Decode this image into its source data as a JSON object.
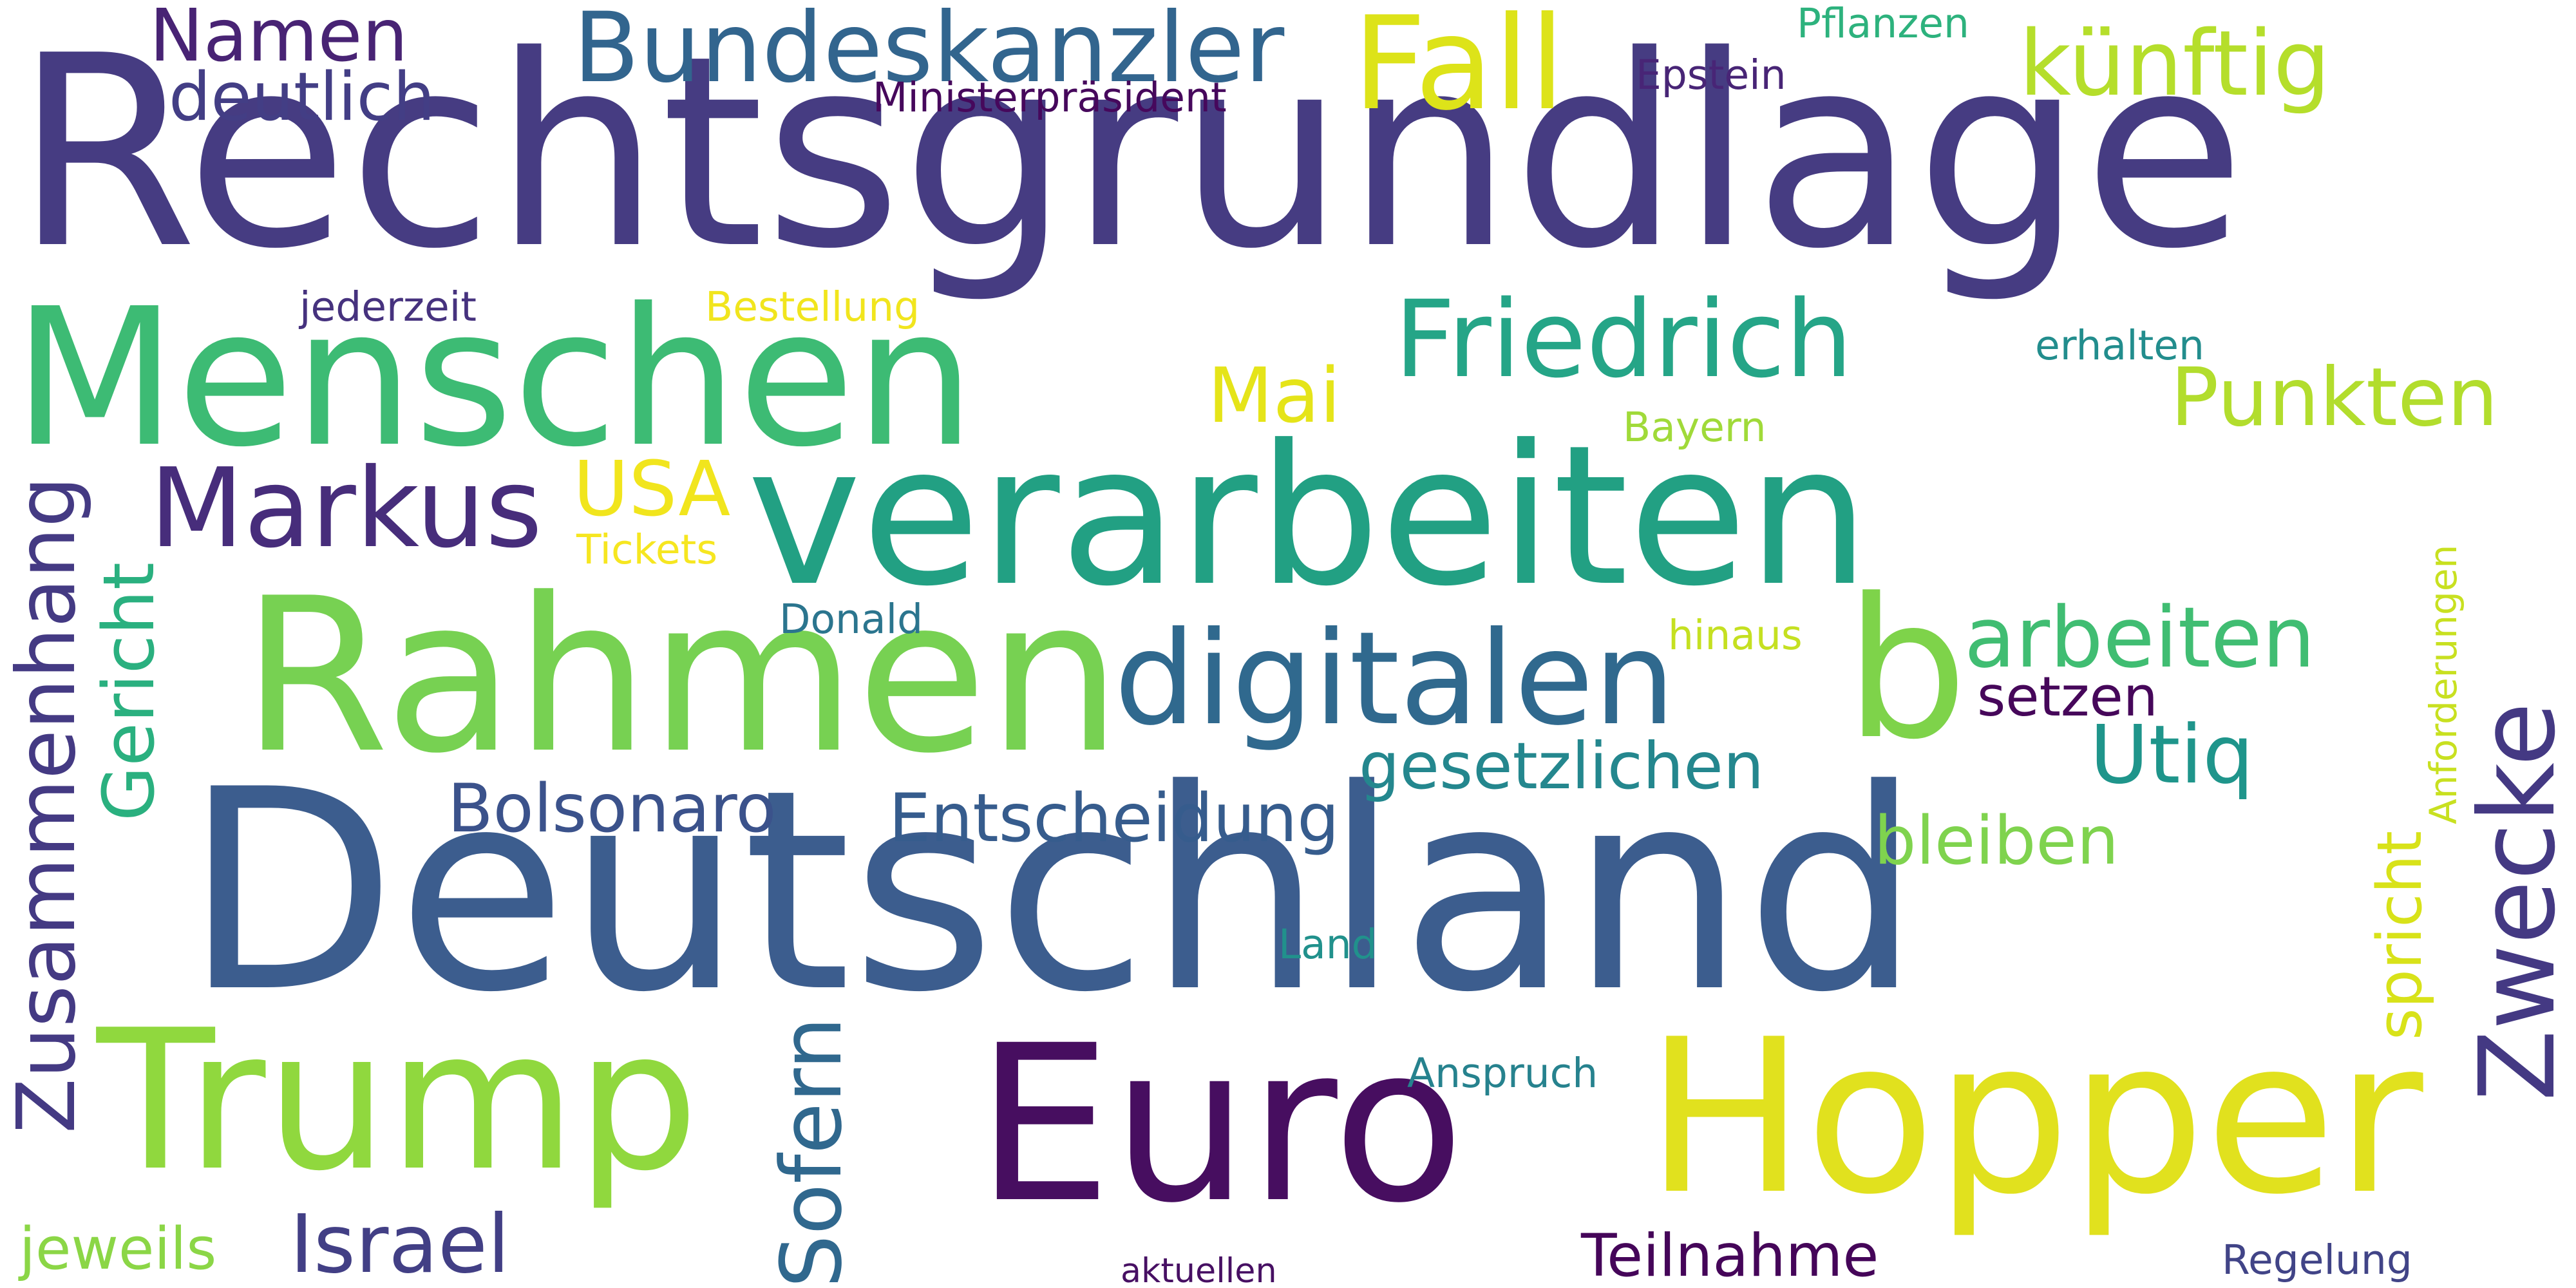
{
  "words": [
    {
      "text": "Rechtsgrundlage",
      "color": "#463c82"
    },
    {
      "text": "Deutschland",
      "color": "#3c5d8e"
    },
    {
      "text": "verarbeiten",
      "color": "#22a083"
    },
    {
      "text": "Rahmen",
      "color": "#77d152"
    },
    {
      "text": "Menschen",
      "color": "#3dbb74"
    },
    {
      "text": "Hopper",
      "color": "#e1e11e"
    },
    {
      "text": "Euro",
      "color": "#470e60"
    },
    {
      "text": "Trump",
      "color": "#90d83e"
    },
    {
      "text": "b",
      "color": "#7ed34a"
    },
    {
      "text": "Zwecke",
      "color": "#443983"
    },
    {
      "text": "digitalen",
      "color": "#30698e"
    },
    {
      "text": "Friedrich",
      "color": "#25a587"
    },
    {
      "text": "Markus",
      "color": "#472d7b"
    },
    {
      "text": "Bundeskanzler",
      "color": "#32658e"
    },
    {
      "text": "Fall",
      "color": "#dde319"
    },
    {
      "text": "künftig",
      "color": "#b5de2b"
    },
    {
      "text": "Namen",
      "color": "#482374"
    },
    {
      "text": "deutlich",
      "color": "#433e85"
    },
    {
      "text": "Zusammenhang",
      "color": "#443a83"
    },
    {
      "text": "Gericht",
      "color": "#2ab07f"
    },
    {
      "text": "Sofern",
      "color": "#30688e"
    },
    {
      "text": "Punkten",
      "color": "#b2dd2d"
    },
    {
      "text": "arbeiten",
      "color": "#40bd72"
    },
    {
      "text": "Utiq",
      "color": "#1f958b"
    },
    {
      "text": "gesetzlichen",
      "color": "#24878e"
    },
    {
      "text": "Entscheidung",
      "color": "#365c8d"
    },
    {
      "text": "Bolsonaro",
      "color": "#3b528b"
    },
    {
      "text": "Israel",
      "color": "#423f85"
    },
    {
      "text": "Teilnahme",
      "color": "#450559"
    },
    {
      "text": "setzen",
      "color": "#46075a"
    },
    {
      "text": "bleiben",
      "color": "#7fd34e"
    },
    {
      "text": "spricht",
      "color": "#d8e219"
    },
    {
      "text": "Anforderungen",
      "color": "#c8e020"
    },
    {
      "text": "Mai",
      "color": "#e5e419"
    },
    {
      "text": "USA",
      "color": "#f1e51d"
    },
    {
      "text": "Tickets",
      "color": "#f6e620"
    },
    {
      "text": "jederzeit",
      "color": "#46327e"
    },
    {
      "text": "Bestellung",
      "color": "#f1e51d"
    },
    {
      "text": "Ministerpräsident",
      "color": "#46085c"
    },
    {
      "text": "Epstein",
      "color": "#482576"
    },
    {
      "text": "Pflanzen",
      "color": "#2db27d"
    },
    {
      "text": "erhalten",
      "color": "#228d8d"
    },
    {
      "text": "Bayern",
      "color": "#a0da39"
    },
    {
      "text": "Donald",
      "color": "#2b758e"
    },
    {
      "text": "hinaus",
      "color": "#c5e021"
    },
    {
      "text": "Land",
      "color": "#21918c"
    },
    {
      "text": "Anspruch",
      "color": "#26828e"
    },
    {
      "text": "jeweils",
      "color": "#8bd646"
    },
    {
      "text": "aktuellen",
      "color": "#471063"
    },
    {
      "text": "Regelung",
      "color": "#414487"
    }
  ]
}
